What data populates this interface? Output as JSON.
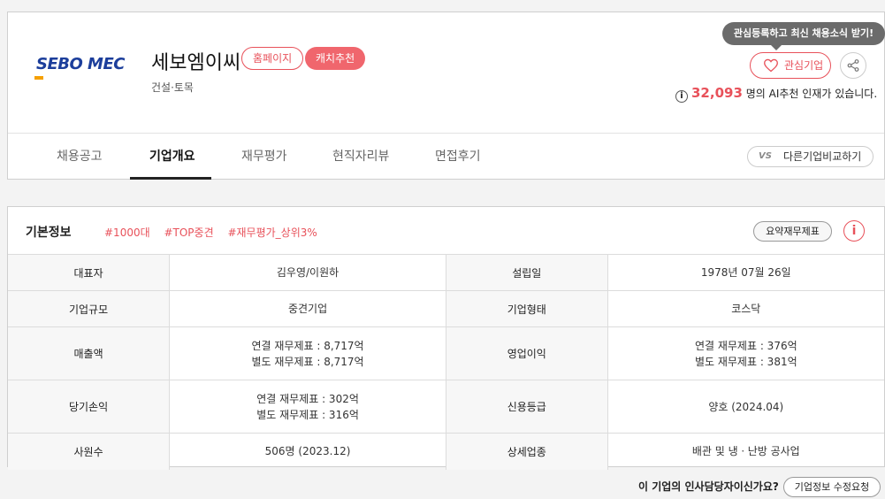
{
  "company": {
    "logo_text": "SEBO MEC",
    "name": "세보엠이씨",
    "category": "건설·토목",
    "homepage_label": "홈페이지",
    "catch_label": "캐치추천"
  },
  "actions": {
    "tooltip": "관심등록하고 최신 채용소식 받기!",
    "favorite_label": "관심기업",
    "share_icon": "share-icon"
  },
  "recommend": {
    "count": "32,093",
    "text": "명의 AI추천 인재가 있습니다."
  },
  "tabs": [
    {
      "label": "채용공고"
    },
    {
      "label": "기업개요",
      "active": true
    },
    {
      "label": "재무평가"
    },
    {
      "label": "현직자리뷰"
    },
    {
      "label": "면접후기"
    }
  ],
  "compare": {
    "vs": "VS",
    "label": "다른기업비교하기"
  },
  "info": {
    "title": "기본정보",
    "hashtags": [
      "#1000대",
      "#TOP중견",
      "#재무평가_상위3%"
    ],
    "summary_button": "요약재무제표",
    "rows": [
      {
        "l1": "대표자",
        "v1": [
          "김우영/이원하"
        ],
        "l2": "설립일",
        "v2": [
          "1978년 07월 26일"
        ]
      },
      {
        "l1": "기업규모",
        "v1": [
          "중견기업"
        ],
        "l2": "기업형태",
        "v2": [
          "코스닥"
        ]
      },
      {
        "l1": "매출액",
        "v1": [
          "연결 재무제표 : 8,717억",
          "별도 재무제표 : 8,717억"
        ],
        "l2": "영업이익",
        "v2": [
          "연결 재무제표 : 376억",
          "별도 재무제표 : 381억"
        ]
      },
      {
        "l1": "당기손익",
        "v1": [
          "연결 재무제표 : 302억",
          "별도 재무제표 : 316억"
        ],
        "l2": "신용등급",
        "v2": [
          "양호 (2024.04)"
        ]
      },
      {
        "l1": "사원수",
        "v1": [
          "506명 (2023.12)"
        ],
        "l2": "상세업종",
        "v2": [
          "배관 및 냉ㆍ난방 공사업"
        ]
      }
    ]
  },
  "footer": {
    "question": "이 기업의 인사담당자이신가요?",
    "edit_button": "기업정보 수정요청"
  },
  "colors": {
    "accent": "#e8515a",
    "logo_blue": "#1c3e9b",
    "logo_orange": "#f5a000"
  }
}
